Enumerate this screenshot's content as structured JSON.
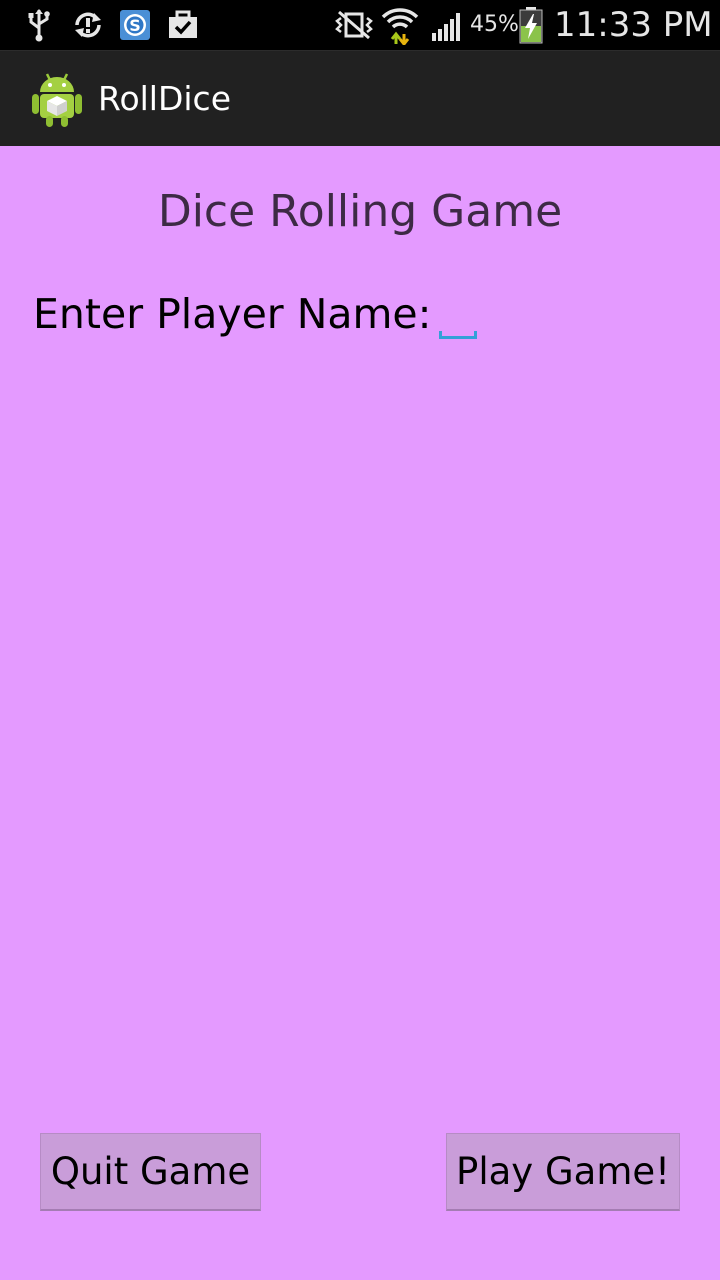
{
  "status_bar": {
    "icons": {
      "usb": "usb-icon",
      "sync": "sync-icon",
      "skype": "skype-icon",
      "task": "briefcase-check-icon",
      "mute": "vibrate-mute-icon",
      "wifi": "wifi-icon",
      "signal": "signal-icon",
      "battery": "battery-charging-icon"
    },
    "battery_percent": "45%",
    "time": "11:33 PM"
  },
  "action_bar": {
    "app_icon": "android-dice-app-icon",
    "title": "RollDice"
  },
  "main": {
    "title": "Dice Rolling Game",
    "player_name_label": "Enter Player Name:",
    "player_name_value": "",
    "quit_button": "Quit Game",
    "play_button": "Play Game!"
  },
  "colors": {
    "content_background": "#e49aff",
    "action_bar_background": "#212121",
    "status_bar_background": "#000000",
    "button_background": "#c99dd9",
    "input_underline": "#33a0d8"
  }
}
